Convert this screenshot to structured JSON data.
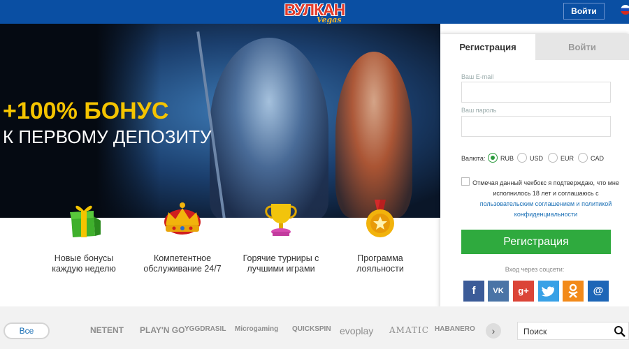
{
  "header": {
    "logo_main": "ВУЛКАН",
    "logo_sub": "Vegas",
    "login_button": "Войти",
    "language_icon": "russian-flag-icon"
  },
  "hero": {
    "title": "+100% БОНУС",
    "subtitle": "К ПЕРВОМУ ДЕПОЗИТУ"
  },
  "features": [
    {
      "icon": "gift-icon",
      "text": "Новые бонусы каждую неделю"
    },
    {
      "icon": "crown-icon",
      "text": "Компетентное обслуживание 24/7"
    },
    {
      "icon": "trophy-icon",
      "text": "Горячие турниры с лучшими играми"
    },
    {
      "icon": "medal-icon",
      "text": "Программа лояльности"
    }
  ],
  "registration": {
    "tabs": [
      "Регистрация",
      "Войти"
    ],
    "email_label": "Ваш E-mail",
    "password_label": "Ваш пароль",
    "currency_label": "Валюта:",
    "currencies": [
      "RUB",
      "USD",
      "EUR",
      "CAD"
    ],
    "selected_currency": "RUB",
    "terms_text": "Отмечая данный чекбокс я подтверждаю, что мне исполнилось 18 лет и соглашаюсь с",
    "terms_link": "пользовательским соглашением и политикой конфиденциальности",
    "submit_button": "Регистрация",
    "social_label": "Вход через соцсети:",
    "socials": [
      "facebook-icon",
      "vk-icon",
      "google-plus-icon",
      "twitter-icon",
      "odnoklassniki-icon",
      "mail-icon"
    ]
  },
  "providers_bar": {
    "all_button": "Все",
    "providers": [
      "NETENT",
      "PLAY'N GO",
      "YGGDRASIL",
      "Microgaming",
      "QUICKSPIN",
      "evoplay",
      "AMATIC",
      "HABANERO"
    ],
    "next_icon": "chevron-right-icon",
    "search_placeholder": "Поиск"
  },
  "colors": {
    "header_blue": "#0a4fa3",
    "bonus_yellow": "#f5c400",
    "register_green": "#2faa3e",
    "link_blue": "#1a6fb5"
  }
}
